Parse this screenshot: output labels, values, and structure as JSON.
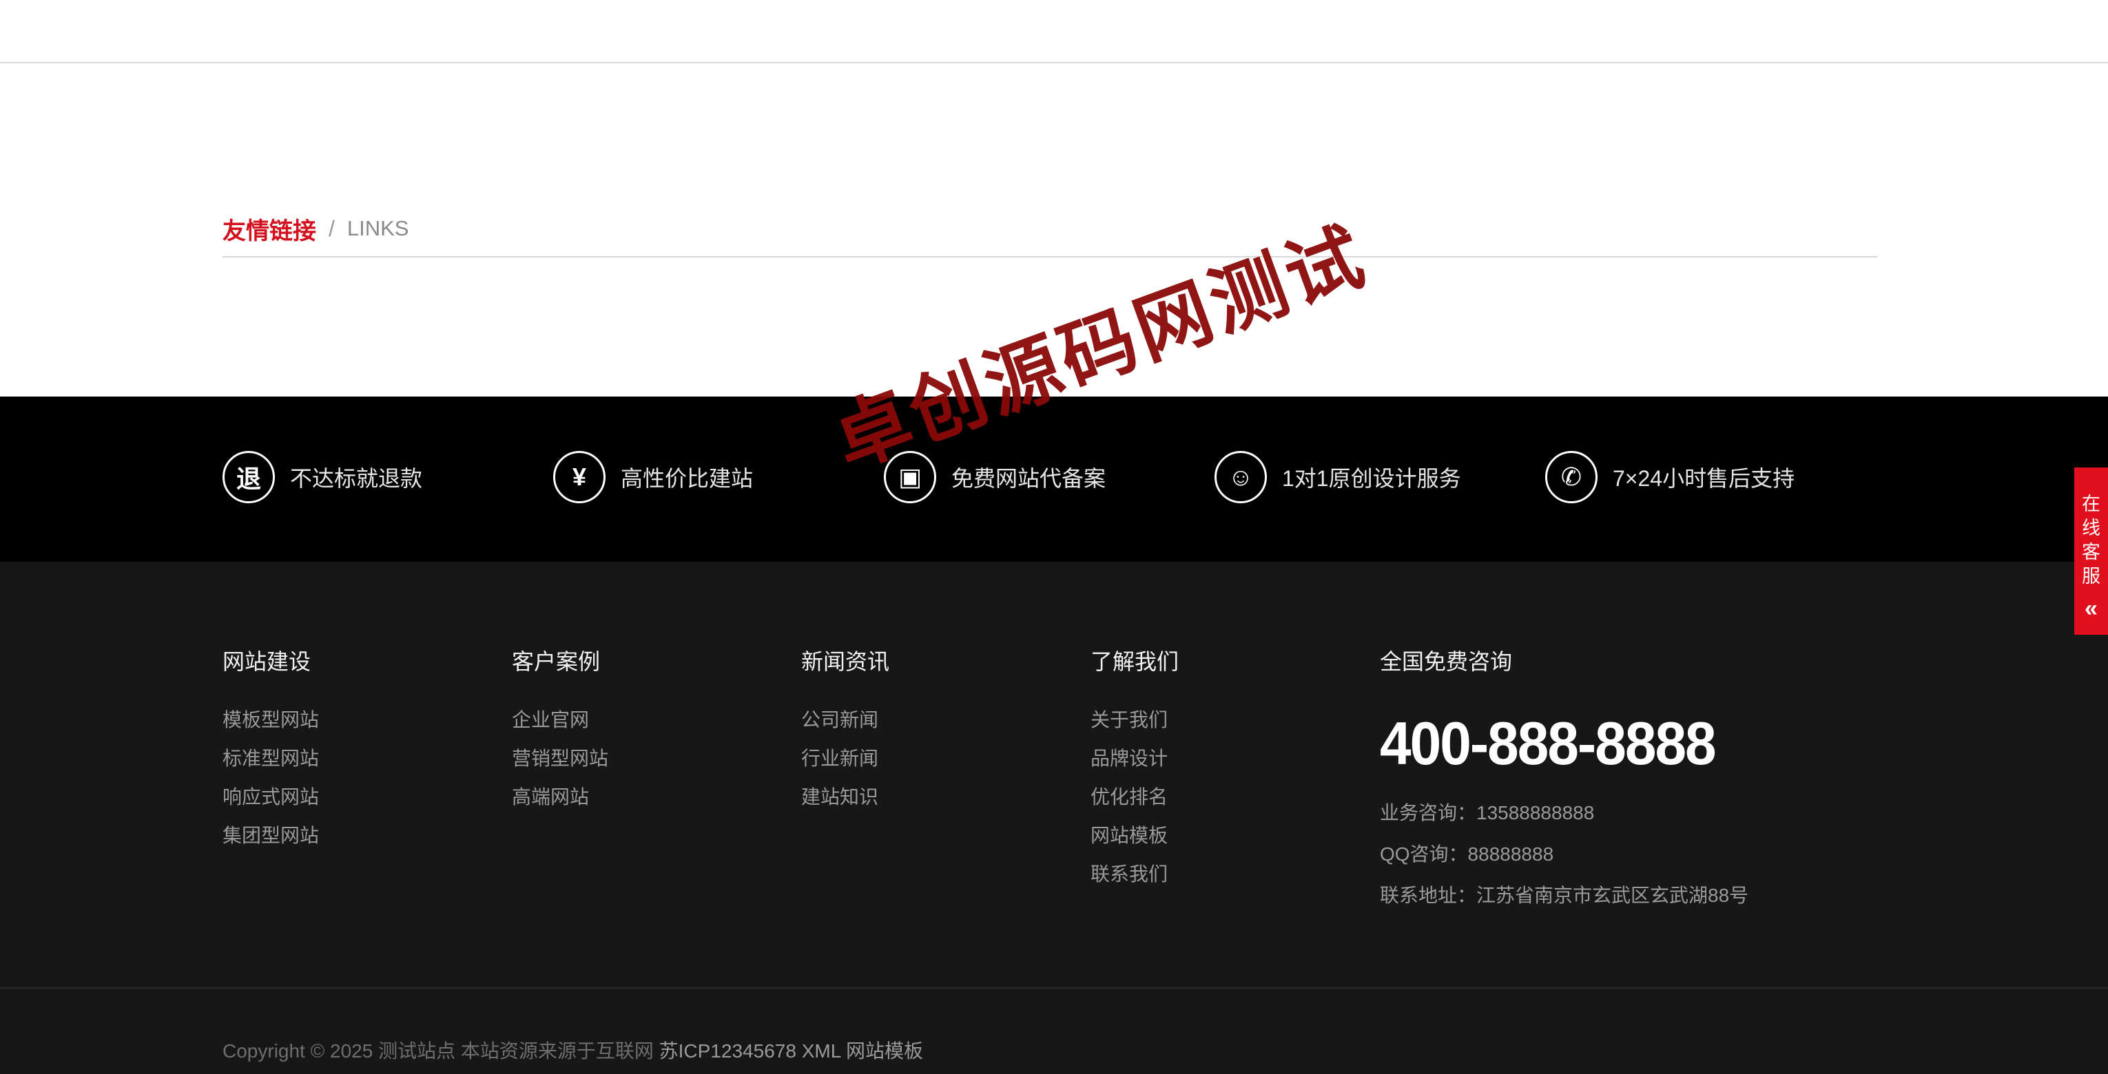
{
  "links": {
    "title": "友情链接",
    "separator": "/",
    "subtitle": "LINKS"
  },
  "services": [
    {
      "icon": "refund-icon",
      "icon_text": "退",
      "label": "不达标就退款"
    },
    {
      "icon": "yen-icon",
      "icon_text": "¥",
      "label": "高性价比建站"
    },
    {
      "icon": "record-icon",
      "icon_text": "▣",
      "label": "免费网站代备案"
    },
    {
      "icon": "designer-icon",
      "icon_text": "☺",
      "label": "1对1原创设计服务"
    },
    {
      "icon": "phone-icon",
      "icon_text": "✆",
      "label": "7×24小时售后支持"
    }
  ],
  "footer": {
    "columns": [
      {
        "title": "网站建设",
        "links": [
          "模板型网站",
          "标准型网站",
          "响应式网站",
          "集团型网站"
        ]
      },
      {
        "title": "客户案例",
        "links": [
          "企业官网",
          "营销型网站",
          "高端网站"
        ]
      },
      {
        "title": "新闻资讯",
        "links": [
          "公司新闻",
          "行业新闻",
          "建站知识"
        ]
      },
      {
        "title": "了解我们",
        "links": [
          "关于我们",
          "品牌设计",
          "优化排名",
          "网站模板",
          "联系我们"
        ]
      }
    ],
    "contact": {
      "title": "全国免费咨询",
      "phone": "400-888-8888",
      "business": "业务咨询：13588888888",
      "qq": "QQ咨询：88888888",
      "address": "联系地址：江苏省南京市玄武区玄武湖88号"
    },
    "copyright": {
      "text": "Copyright © 2025 测试站点 本站资源来源于互联网",
      "icp": "苏ICP12345678",
      "xml": "XML",
      "template": "网站模板"
    }
  },
  "watermark": "卓创源码网测试",
  "side_service": {
    "chars": [
      "在",
      "线",
      "客",
      "服"
    ],
    "arrow": "«"
  },
  "colors": {
    "accent": "#d3101d",
    "band": "#000000",
    "footer": "#171717"
  }
}
